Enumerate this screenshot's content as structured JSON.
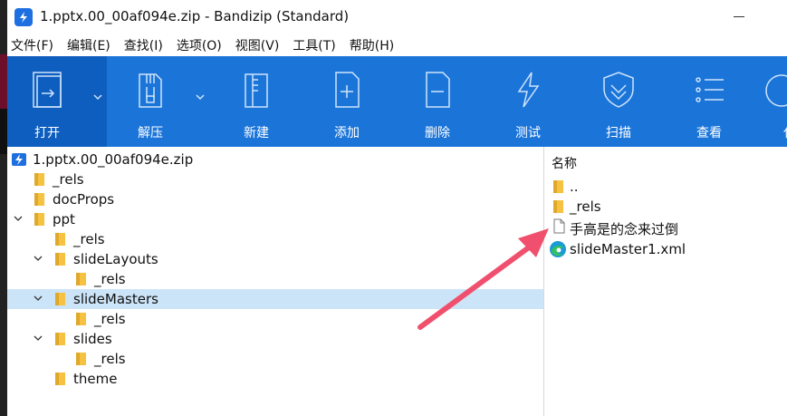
{
  "window": {
    "title": "1.pptx.00_00af094e.zip - Bandizip (Standard)"
  },
  "menu": [
    "文件(F)",
    "编辑(E)",
    "查找(I)",
    "选项(O)",
    "视图(V)",
    "工具(T)",
    "帮助(H)"
  ],
  "toolbar": {
    "open": "打开",
    "extract": "解压",
    "new": "新建",
    "add": "添加",
    "delete": "删除",
    "test": "测试",
    "scan": "扫描",
    "view": "查看",
    "more": "代"
  },
  "tree": {
    "root": "1.pptx.00_00af094e.zip",
    "items": [
      {
        "label": "_rels"
      },
      {
        "label": "docProps"
      },
      {
        "label": "ppt"
      },
      {
        "label": "_rels"
      },
      {
        "label": "slideLayouts"
      },
      {
        "label": "_rels"
      },
      {
        "label": "slideMasters"
      },
      {
        "label": "_rels"
      },
      {
        "label": "slides"
      },
      {
        "label": "_rels"
      },
      {
        "label": "theme"
      }
    ]
  },
  "filelist": {
    "header": "名称",
    "items": [
      {
        "label": ".."
      },
      {
        "label": "_rels"
      },
      {
        "label": "手高是的念来过倒"
      },
      {
        "label": "slideMaster1.xml"
      }
    ]
  },
  "colors": {
    "toolbar": "#1b75d9",
    "toolbar_open": "#0e5ebf",
    "selection": "#cce4f7",
    "folder": "#f5c242",
    "annotation_arrow": "#f0506e"
  }
}
